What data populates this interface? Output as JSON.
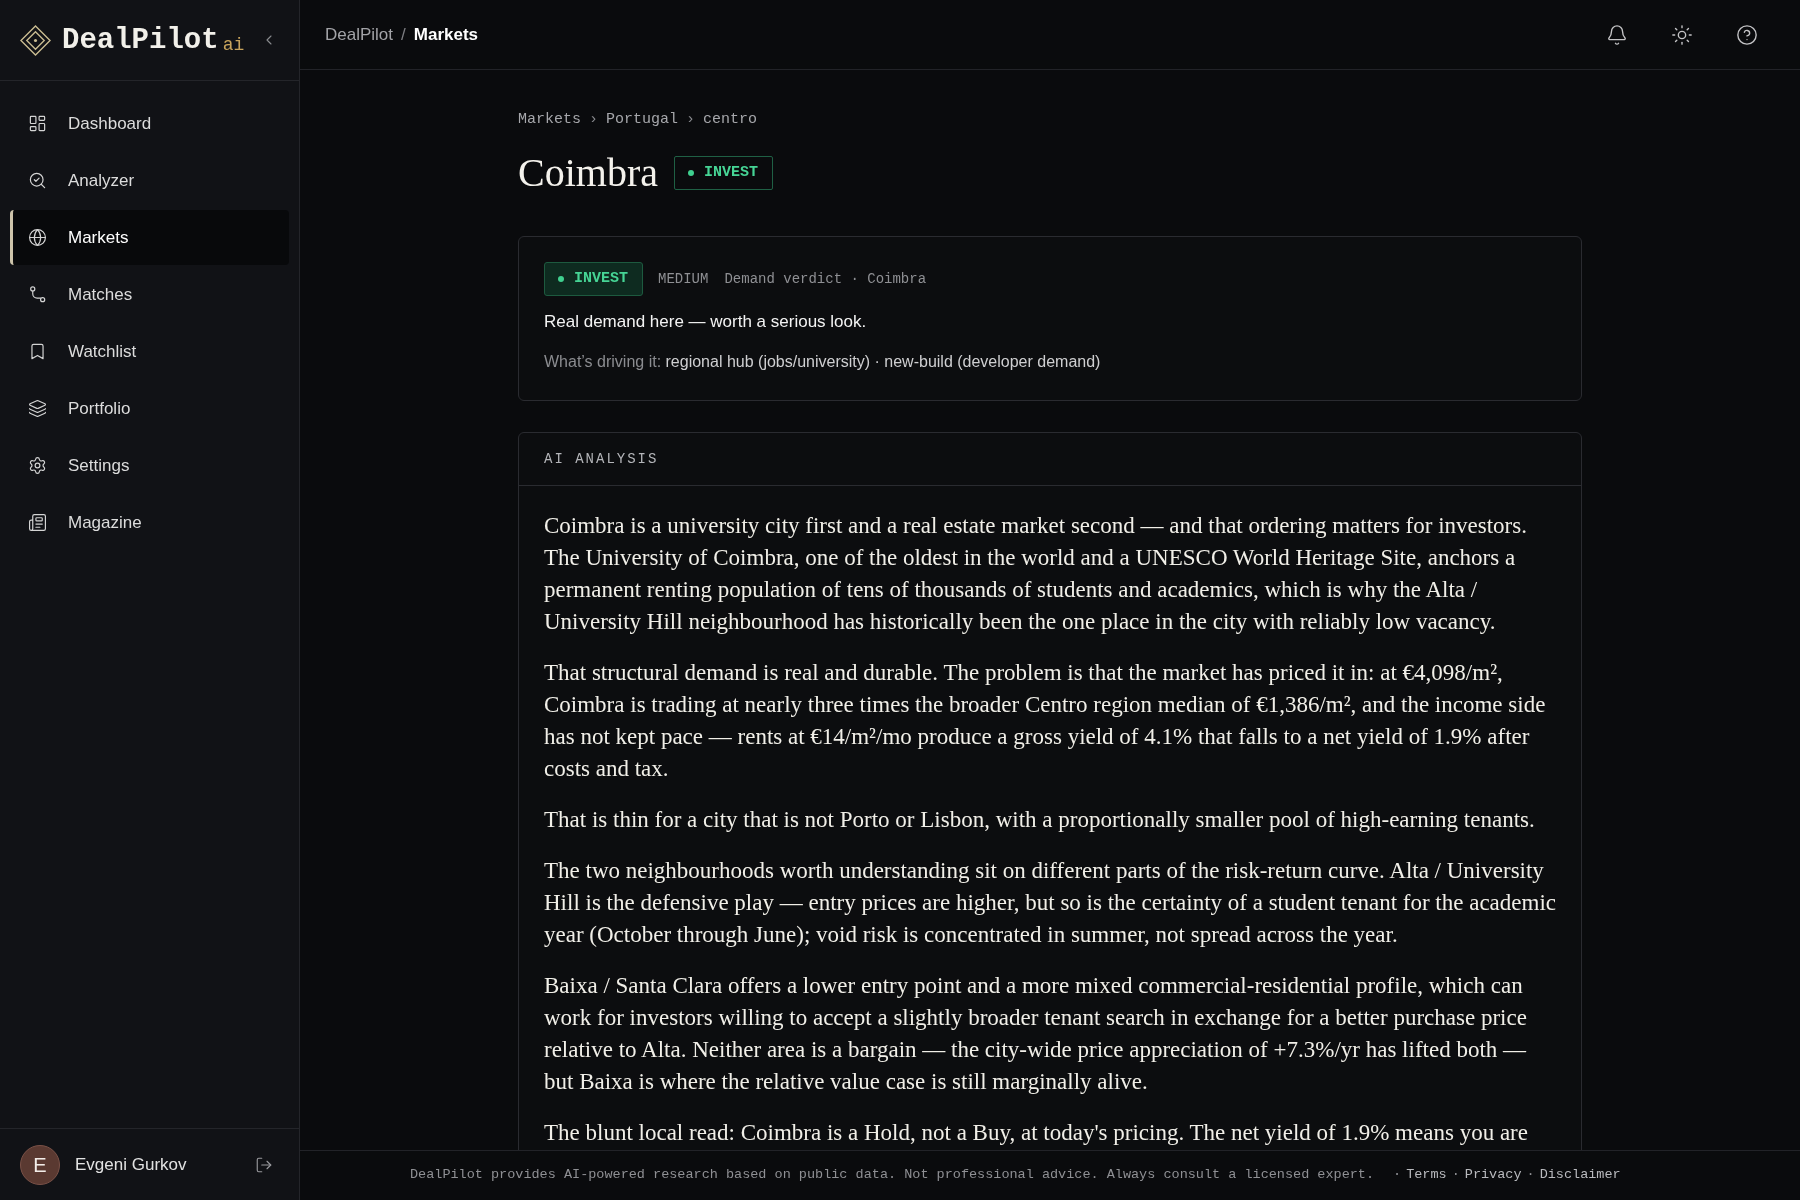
{
  "sidebar": {
    "logo": {
      "name": "DealPilot",
      "suffix": "ai"
    },
    "nav": [
      {
        "label": "Dashboard",
        "selected": false
      },
      {
        "label": "Analyzer",
        "selected": false
      },
      {
        "label": "Markets",
        "selected": true
      },
      {
        "label": "Matches",
        "selected": false
      },
      {
        "label": "Watchlist",
        "selected": false
      },
      {
        "label": "Portfolio",
        "selected": false
      },
      {
        "label": "Settings",
        "selected": false
      },
      {
        "label": "Magazine",
        "selected": false
      }
    ],
    "user": {
      "initial": "E",
      "name": "Evgeni Gurkov"
    }
  },
  "header": {
    "breadcrumb": [
      {
        "label": "DealPilot",
        "current": false
      },
      {
        "label": "Markets",
        "current": true
      }
    ],
    "separator": "/"
  },
  "page": {
    "breadcrumb": {
      "items": [
        "Markets",
        "Portugal",
        "centro"
      ],
      "separator": "›"
    },
    "title": "Coimbra",
    "badge": "INVEST"
  },
  "verdict_card": {
    "badge": "INVEST",
    "confidence": "MEDIUM",
    "caption": "Demand verdict · Coimbra",
    "headline": "Real demand here — worth a serious look.",
    "drivers_label": "What’s driving it:",
    "drivers": "regional hub (jobs/university) · new-build (developer demand)"
  },
  "analysis": {
    "heading": "AI ANALYSIS",
    "paragraphs": [
      "Coimbra is a university city first and a real estate market second — and that ordering matters for investors. The University of Coimbra, one of the oldest in the world and a UNESCO World Heritage Site, anchors a permanent renting population of tens of thousands of students and academics, which is why the Alta / University Hill neighbourhood has historically been the one place in the city with reliably low vacancy.",
      "That structural demand is real and durable. The problem is that the market has priced it in: at €4,098/m², Coimbra is trading at nearly three times the broader Centro region median of €1,386/m², and the income side has not kept pace — rents at €14/m²/mo produce a gross yield of 4.1% that falls to a net yield of 1.9% after costs and tax.",
      "That is thin for a city that is not Porto or Lisbon, with a proportionally smaller pool of high-earning tenants.",
      "The two neighbourhoods worth understanding sit on different parts of the risk-return curve. Alta / University Hill is the defensive play — entry prices are higher, but so is the certainty of a student tenant for the academic year (October through June); void risk is concentrated in summer, not spread across the year.",
      "Baixa / Santa Clara offers a lower entry point and a more mixed commercial-residential profile, which can work for investors willing to accept a slightly broader tenant search in exchange for a better purchase price relative to Alta. Neither area is a bargain — the city-wide price appreciation of +7.3%/yr has lifted both — but Baixa is where the relative value case is still marginally alive.",
      "The blunt local read: Coimbra is a Hold, not a Buy, at today's pricing. The net yield of 1.9% means you are"
    ]
  },
  "footer": {
    "disclaimer": "DealPilot provides AI-powered research based on public data. Not professional advice. Always consult a licensed expert.",
    "separator": "·",
    "links": [
      "Terms",
      "Privacy",
      "Disclaimer"
    ]
  }
}
